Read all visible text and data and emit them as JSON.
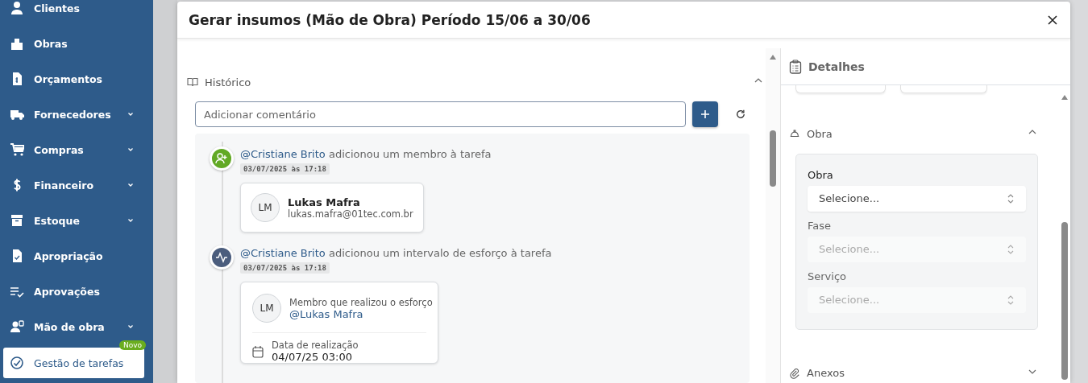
{
  "sidebar": {
    "items": [
      {
        "label": "Clientes",
        "kind": "link",
        "selected": false
      },
      {
        "label": "Obras",
        "kind": "link",
        "selected": false
      },
      {
        "label": "Orçamentos",
        "kind": "link",
        "selected": false
      },
      {
        "label": "Fornecedores",
        "kind": "group",
        "selected": false
      },
      {
        "label": "Compras",
        "kind": "group",
        "selected": false
      },
      {
        "label": "Financeiro",
        "kind": "group",
        "selected": false
      },
      {
        "label": "Estoque",
        "kind": "group",
        "selected": false
      },
      {
        "label": "Apropriação",
        "kind": "link",
        "selected": false
      },
      {
        "label": "Aprovações",
        "kind": "link",
        "selected": false
      },
      {
        "label": "Mão de obra",
        "kind": "group",
        "selected": false
      },
      {
        "label": "Gestão de tarefas",
        "kind": "link",
        "selected": true,
        "badge": "Novo"
      }
    ]
  },
  "modal": {
    "title": "Gerar insumos (Mão de Obra) Período 15/06 a 30/06",
    "history": {
      "title": "Histórico",
      "expanded": true,
      "comment": {
        "placeholder": "Adicionar comentário"
      },
      "events": [
        {
          "kind": "member",
          "user": "@Cristiane Brito",
          "action": "adicionou um membro à tarefa",
          "time": "03/07/2025 às 17:18",
          "initials": "LM",
          "name": "Lukas Mafra",
          "email": "lukas.mafra@01tec.com.br"
        },
        {
          "kind": "effort",
          "user": "@Cristiane Brito",
          "action": "adicionou um intervalo de esforço à tarefa",
          "time": "03/07/2025 às 17:18",
          "initials": "LM",
          "label": "Membro que realizou o esforço",
          "member": "@Lukas Mafra",
          "date_label": "Data de realização",
          "date": "04/07/25 03:00"
        }
      ]
    },
    "details": {
      "title": "Detalhes",
      "sections": [
        {
          "title": "Obra",
          "expanded": true,
          "fields": [
            {
              "label": "Obra",
              "placeholder": "Selecione...",
              "disabled": false
            },
            {
              "label": "Fase",
              "placeholder": "Selecione...",
              "disabled": true
            },
            {
              "label": "Serviço",
              "placeholder": "Selecione...",
              "disabled": true
            }
          ]
        },
        {
          "title": "Anexos",
          "expanded": false
        }
      ]
    }
  }
}
